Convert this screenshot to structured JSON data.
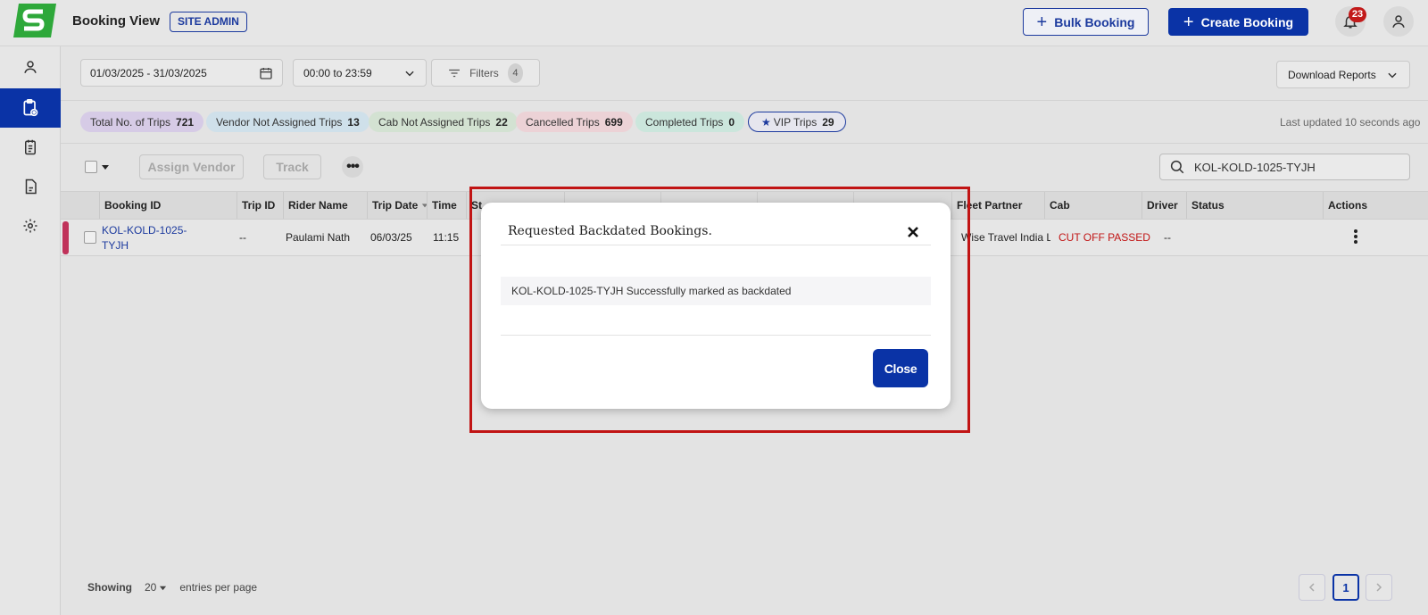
{
  "header": {
    "title": "Booking View",
    "role_badge": "SITE ADMIN",
    "bulk_booking_label": "Bulk Booking",
    "create_booking_label": "Create Booking",
    "notification_count": "23",
    "brand_color": "#0a33a6",
    "logo_color": "#2ea83a"
  },
  "sidebar": {
    "items": [
      {
        "icon": "user-icon"
      },
      {
        "icon": "booking-view-icon",
        "active": true
      },
      {
        "icon": "notes-icon"
      },
      {
        "icon": "document-icon"
      },
      {
        "icon": "gear-icon"
      }
    ]
  },
  "filters": {
    "date_range": "01/03/2025 - 31/03/2025",
    "time_range": "00:00 to 23:59",
    "filters_label": "Filters",
    "filters_count": "4",
    "download_label": "Download Reports"
  },
  "stats": [
    {
      "label": "Total No. of Trips",
      "value": "721",
      "color": "#d6cbe6"
    },
    {
      "label": "Vendor Not Assigned Trips",
      "value": "13",
      "color": "#cfe0ea"
    },
    {
      "label": "Cab Not Assigned Trips",
      "value": "22",
      "color": "#d3e2d2"
    },
    {
      "label": "Cancelled Trips",
      "value": "699",
      "color": "#ecd2d6"
    },
    {
      "label": "Completed Trips",
      "value": "0",
      "color": "#cbe6dc"
    },
    {
      "label": "VIP Trips",
      "value": "29",
      "color": "#e6e6ee"
    }
  ],
  "last_updated": "Last updated 10 seconds ago",
  "toolbar": {
    "assign_vendor_label": "Assign Vendor",
    "track_label": "Track",
    "more_label": "•••",
    "search_value": "KOL-KOLD-1025-TYJH"
  },
  "table": {
    "columns": [
      "Booking ID",
      "Trip ID",
      "Rider Name",
      "Trip Date",
      "Time",
      "St",
      "",
      "",
      "",
      "",
      "Fleet Partner",
      "Cab",
      "Driver",
      "Status",
      "Actions"
    ],
    "rows": [
      {
        "booking_id_line1": "KOL-KOLD-1025-",
        "booking_id_line2": "TYJH",
        "trip_id": "--",
        "rider_name": "Paulami Nath",
        "trip_date": "06/03/25",
        "time": "11:15",
        "fleet_partner": "Wise Travel India Li...",
        "cab": "CUT OFF PASSED",
        "driver": "--",
        "status": ""
      }
    ]
  },
  "pagination": {
    "showing_label": "Showing",
    "page_size": "20",
    "entries_label": "entries per page",
    "current_page": "1"
  },
  "dialog": {
    "title": "Requested Backdated Bookings.",
    "message": "KOL-KOLD-1025-TYJH Successfully marked as backdated",
    "close_label": "Close"
  }
}
